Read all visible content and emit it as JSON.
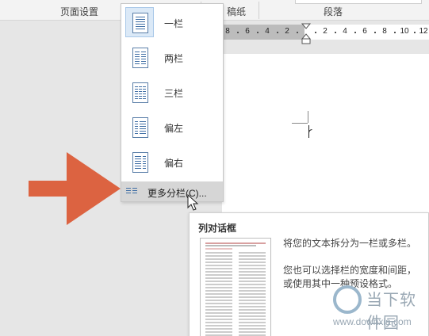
{
  "ribbon": {
    "page_setup": "页面设置",
    "manuscript": "稿纸",
    "paragraph": "段落"
  },
  "ruler": {
    "left_ticks": [
      "8",
      "6",
      "4",
      "2"
    ],
    "right_ticks": [
      "2",
      "4",
      "6",
      "8",
      "10",
      "12"
    ]
  },
  "columns_menu": {
    "items": [
      {
        "label": "一栏",
        "icon": "one-column-icon",
        "selected": true
      },
      {
        "label": "两栏",
        "icon": "two-columns-icon",
        "selected": false
      },
      {
        "label": "三栏",
        "icon": "three-columns-icon",
        "selected": false
      },
      {
        "label": "偏左",
        "icon": "left-column-icon",
        "selected": false
      },
      {
        "label": "偏右",
        "icon": "right-column-icon",
        "selected": false
      }
    ],
    "more": "更多分栏(C)..."
  },
  "tooltip": {
    "title": "列对话框",
    "line1": "将您的文本拆分为一栏或多栏。",
    "line2": "您也可以选择栏的宽度和间距，或使用其中一种预设格式。"
  },
  "watermark": {
    "cn": "当下软件园",
    "url": "www.downxia.com"
  },
  "colors": {
    "arrow": "#dc6341",
    "accent_blue": "#3f6ea5",
    "selected_bg": "#dbe9f7"
  }
}
